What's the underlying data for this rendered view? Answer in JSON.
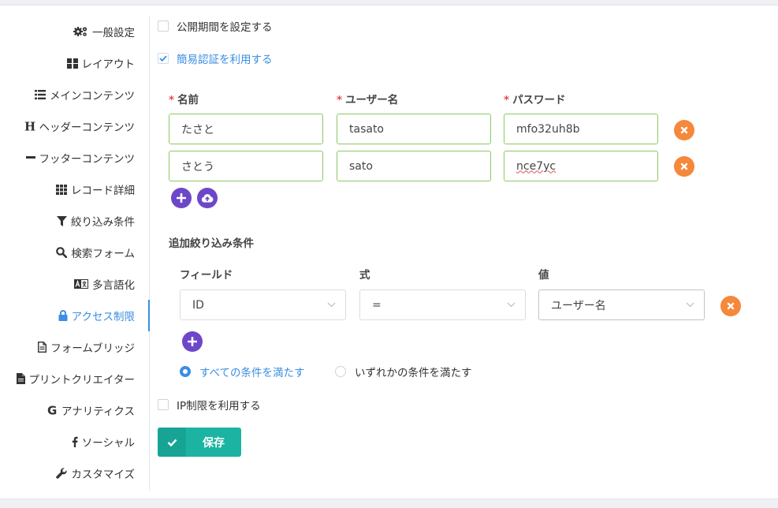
{
  "sidebar": {
    "items": [
      {
        "label": "一般設定",
        "icon": "gears-icon"
      },
      {
        "label": "レイアウト",
        "icon": "layout-grid-icon"
      },
      {
        "label": "メインコンテンツ",
        "icon": "list-icon"
      },
      {
        "label": "ヘッダーコンテンツ",
        "icon": "heading-icon"
      },
      {
        "label": "フッターコンテンツ",
        "icon": "minus-icon"
      },
      {
        "label": "レコード詳細",
        "icon": "table-grid-icon"
      },
      {
        "label": "絞り込み条件",
        "icon": "filter-icon"
      },
      {
        "label": "検索フォーム",
        "icon": "search-icon"
      },
      {
        "label": "多言語化",
        "icon": "translate-icon"
      },
      {
        "label": "アクセス制限",
        "icon": "lock-icon"
      },
      {
        "label": "フォームブリッジ",
        "icon": "document-icon"
      },
      {
        "label": "プリントクリエイター",
        "icon": "file-icon"
      },
      {
        "label": "アナリティクス",
        "icon": "google-icon"
      },
      {
        "label": "ソーシャル",
        "icon": "facebook-icon"
      },
      {
        "label": "カスタマイズ",
        "icon": "wrench-icon"
      }
    ],
    "active": "アクセス制限"
  },
  "access": {
    "publish_period_label": "公開期間を設定する",
    "publish_period_checked": false,
    "basic_auth_label": "簡易認証を利用する",
    "basic_auth_checked": true,
    "columns": {
      "name": "名前",
      "username": "ユーザー名",
      "password": "パスワード"
    },
    "required_mark": "*",
    "users": [
      {
        "name": "たさと",
        "username": "tasato",
        "password": "mfo32uh8b"
      },
      {
        "name": "さとう",
        "username": "sato",
        "password": "nce7yc"
      }
    ],
    "extra_filter": {
      "title": "追加絞り込み条件",
      "columns": {
        "field": "フィールド",
        "operator": "式",
        "value": "値"
      },
      "rows": [
        {
          "field": "ID",
          "operator": "=",
          "value": "ユーザー名"
        }
      ],
      "match_all_label": "すべての条件を満たす",
      "match_any_label": "いずれかの条件を満たす",
      "match_mode": "all"
    },
    "ip_restrict_label": "IP制限を利用する",
    "ip_restrict_checked": false,
    "save_label": "保存"
  },
  "colors": {
    "accent": "#3b8ee0",
    "valid_border": "#8cc865",
    "remove": "#f5883b",
    "add": "#6d47c9",
    "save": "#1db3a2",
    "required": "#e84a4a"
  }
}
